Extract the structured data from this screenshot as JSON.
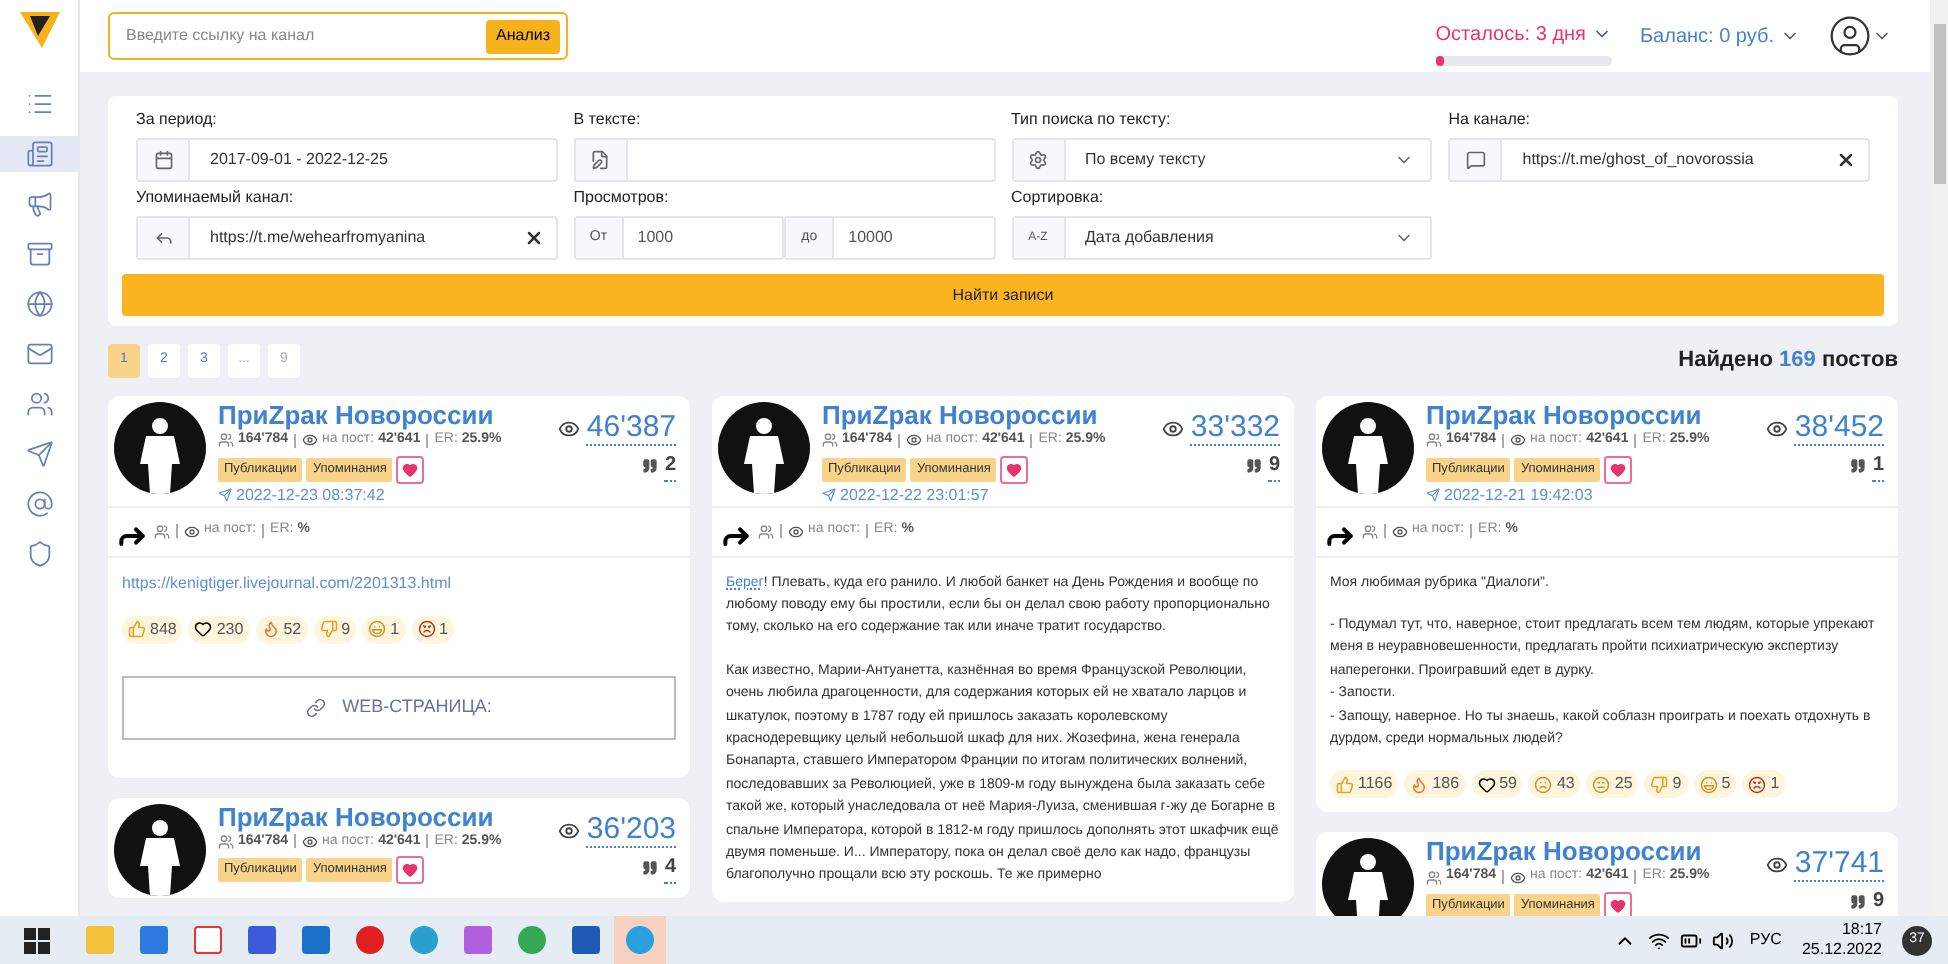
{
  "sidebar": {
    "items": [
      {
        "kind": "list",
        "selected": false
      },
      {
        "kind": "news",
        "selected": true
      },
      {
        "kind": "megaphone",
        "selected": false
      },
      {
        "kind": "archive",
        "selected": false
      },
      {
        "kind": "globe",
        "selected": false
      },
      {
        "kind": "mail",
        "selected": false
      },
      {
        "kind": "users",
        "selected": false
      },
      {
        "kind": "send",
        "selected": false
      },
      {
        "kind": "at",
        "selected": false
      },
      {
        "kind": "shield",
        "selected": false
      }
    ]
  },
  "header": {
    "search": {
      "placeholder": "Введите ссылку на канал"
    },
    "analyze_button": "Анализ",
    "trial": {
      "label": "Осталось: 3 дня",
      "level": 0.05
    },
    "balance": "Баланс: 0 руб."
  },
  "filters": [
    {
      "label": "За период:",
      "kind": "text",
      "value": "2017-09-01 - 2022-12-25"
    },
    {
      "label": "В тексте:",
      "kind": "text"
    },
    {
      "label": "Тип поиска по тексту:",
      "kind": "select",
      "value": "По всему тексту"
    },
    {
      "label": "На канале:",
      "kind": "text",
      "value": "https://t.me/ghost_of_novorossia",
      "clearable": true
    },
    {
      "label": "Упоминаемый канал:",
      "kind": "text",
      "value": "https://t.me/wehearfromyanina",
      "clearable": true
    },
    {
      "label": "Просмотров:",
      "kind": "range",
      "from_label": "От",
      "from": "1000",
      "to_label": "до",
      "to": "10000"
    },
    {
      "label": "Сортировка:",
      "kind": "select",
      "prefix": "A-Z",
      "value": "Дата добавления"
    }
  ],
  "submit_button": "Найти записи",
  "pagination": [
    {
      "label": "1",
      "selected": true,
      "disabled": false
    },
    {
      "label": "2",
      "selected": false,
      "disabled": false
    },
    {
      "label": "3",
      "selected": false,
      "disabled": false
    },
    {
      "label": "...",
      "selected": false,
      "disabled": true
    },
    {
      "label": "9",
      "selected": false,
      "disabled": true
    }
  ],
  "found": {
    "prefix": "Найдено",
    "count": "169",
    "suffix": "постов"
  },
  "columns": [
    [
      {
        "channel": "ПриZрак Новороссии",
        "subscribers": "164'784",
        "per_post_label": "на пост:",
        "per_post": "42'641",
        "er_label": "ER:",
        "er": "25.9%",
        "tags": [
          "Публикации",
          "Упоминания"
        ],
        "date": "2022-12-23 08:37:42",
        "views": "46'387",
        "comments": "2",
        "repost": {
          "per_post_label": "на пост:",
          "er_label": "ER:",
          "er": "%"
        },
        "link": "https://kenigtiger.livejournal.com/2201313.html",
        "reactions": [
          {
            "kind": "thumbs-up",
            "count": "848"
          },
          {
            "kind": "heart",
            "count": "230"
          },
          {
            "kind": "fire",
            "count": "52"
          },
          {
            "kind": "thumbs-down",
            "count": "9"
          },
          {
            "kind": "shocked",
            "count": "1"
          },
          {
            "kind": "angry",
            "count": "1"
          }
        ],
        "web_button": "WEB-СТРАНИЦА:"
      },
      {
        "channel": "ПриZрак Новороссии",
        "subscribers": "164'784",
        "per_post_label": "на пост:",
        "per_post": "42'641",
        "er_label": "ER:",
        "er": "25.9%",
        "tags": [
          "Публикации",
          "Упоминания"
        ],
        "views": "36'203",
        "comments": "4"
      }
    ],
    [
      {
        "channel": "ПриZрак Новороссии",
        "subscribers": "164'784",
        "per_post_label": "на пост:",
        "per_post": "42'641",
        "er_label": "ER:",
        "er": "25.9%",
        "tags": [
          "Публикации",
          "Упоминания"
        ],
        "date": "2022-12-22 23:01:57",
        "views": "33'332",
        "comments": "9",
        "repost": {
          "per_post_label": "на пост:",
          "er_label": "ER:",
          "er": "%"
        },
        "lead_link": "Берег",
        "paragraphs": [
          "! Плевать, куда его ранило. И любой банкет на День Рождения и вообще по любому поводу ему бы простили, если бы он делал свою работу пропорционально тому, сколько на его содержание так или иначе тратит государство.",
          "Как известно, Марии-Антуанетта, казнённая во время Французской Революции, очень любила драгоценности, для содержания которых ей не хватало ларцов и шкатулок, поэтому в 1787 году ей пришлось заказать королевскому краснодеревщику целый небольшой шкаф для них. Жозефина, жена генерала Бонапарта, ставшего Императором Франции по итогам политических волнений, последовавших за Революцией, уже в 1809-м году вынуждена была заказать себе такой же, который унаследовала от неё Мария-Луиза, сменившая г-жу де Богарне в спальне Императора, которой в 1812-м году пришлось дополнять этот шкафчик ещё двумя поменьше. И... Императору, пока он делал своё дело как надо, французы благополучно прощали всю эту роскошь. Те же примерно"
        ]
      }
    ],
    [
      {
        "channel": "ПриZрак Новороссии",
        "subscribers": "164'784",
        "per_post_label": "на пост:",
        "per_post": "42'641",
        "er_label": "ER:",
        "er": "25.9%",
        "tags": [
          "Публикации",
          "Упоминания"
        ],
        "date": "2022-12-21 19:42:03",
        "views": "38'452",
        "comments": "1",
        "repost": {
          "per_post_label": "на пост:",
          "er_label": "ER:",
          "er": "%"
        },
        "paragraphs": [
          "Моя любимая рубрика \"Диалоги\".",
          "- Подумал тут, что, наверное, стоит предлагать всем тем людям, которые упрекают меня в неуравновешенности, предлагать пройти психиатрическую экспертизу наперегонки. Проигравший едет в дурку.\n- Запости.\n- Запощу, наверное. Но ты знаешь, какой соблазн проиграть и поехать отдохнуть в дурдом, среди нормальных людей?"
        ],
        "reactions": [
          {
            "kind": "thumbs-up",
            "count": "1166"
          },
          {
            "kind": "fire",
            "count": "186"
          },
          {
            "kind": "heart",
            "count": "59"
          },
          {
            "kind": "crying",
            "count": "43"
          },
          {
            "kind": "confused",
            "count": "25"
          },
          {
            "kind": "thumbs-down",
            "count": "9"
          },
          {
            "kind": "shocked",
            "count": "5"
          },
          {
            "kind": "angry",
            "count": "1"
          }
        ]
      },
      {
        "channel": "ПриZрак Новороссии",
        "subscribers": "164'784",
        "per_post_label": "на пост:",
        "per_post": "42'641",
        "er_label": "ER:",
        "er": "25.9%",
        "tags": [
          "Публикации",
          "Упоминания"
        ],
        "views": "37'741",
        "comments": "9"
      }
    ]
  ],
  "taskbar": {
    "apps": [
      {
        "kind": "folder"
      },
      {
        "kind": "store"
      },
      {
        "kind": "browser-y"
      },
      {
        "kind": "app"
      },
      {
        "kind": "mail"
      },
      {
        "kind": "opera"
      },
      {
        "kind": "edge"
      },
      {
        "kind": "gem"
      },
      {
        "kind": "chrome",
        "selected": false
      },
      {
        "kind": "word"
      },
      {
        "kind": "telegram",
        "selected": true
      }
    ],
    "language": "РУС",
    "time": "18:17",
    "date": "25.12.2022",
    "notifications": "37"
  }
}
